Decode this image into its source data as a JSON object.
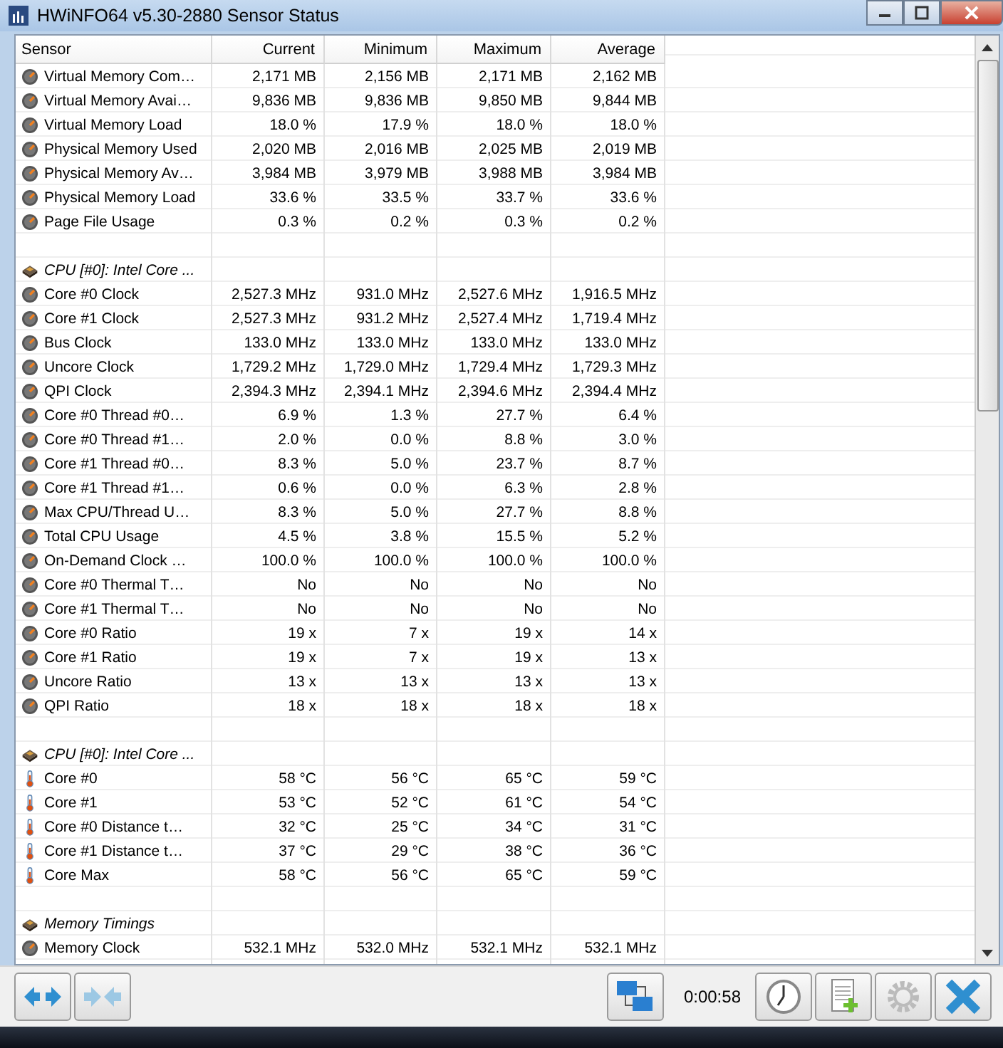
{
  "window": {
    "title": "HWiNFO64 v5.30-2880 Sensor Status"
  },
  "table": {
    "columns": [
      "Sensor",
      "Current",
      "Minimum",
      "Maximum",
      "Average"
    ],
    "rows": [
      {
        "kind": "reading",
        "cells": [
          "Virtual Memory Com…",
          "2,171 MB",
          "2,156 MB",
          "2,171 MB",
          "2,162 MB"
        ]
      },
      {
        "kind": "reading",
        "cells": [
          "Virtual Memory Avai…",
          "9,836 MB",
          "9,836 MB",
          "9,850 MB",
          "9,844 MB"
        ]
      },
      {
        "kind": "reading",
        "cells": [
          "Virtual Memory Load",
          "18.0 %",
          "17.9 %",
          "18.0 %",
          "18.0 %"
        ]
      },
      {
        "kind": "reading",
        "cells": [
          "Physical Memory Used",
          "2,020 MB",
          "2,016 MB",
          "2,025 MB",
          "2,019 MB"
        ]
      },
      {
        "kind": "reading",
        "cells": [
          "Physical Memory Av…",
          "3,984 MB",
          "3,979 MB",
          "3,988 MB",
          "3,984 MB"
        ]
      },
      {
        "kind": "reading",
        "cells": [
          "Physical Memory Load",
          "33.6 %",
          "33.5 %",
          "33.7 %",
          "33.6 %"
        ]
      },
      {
        "kind": "reading",
        "cells": [
          "Page File Usage",
          "0.3 %",
          "0.2 %",
          "0.3 %",
          "0.2 %"
        ]
      },
      {
        "kind": "blank"
      },
      {
        "kind": "header",
        "label": "CPU [#0]: Intel Core ..."
      },
      {
        "kind": "reading",
        "cells": [
          "Core #0 Clock",
          "2,527.3 MHz",
          "931.0 MHz",
          "2,527.6 MHz",
          "1,916.5 MHz"
        ]
      },
      {
        "kind": "reading",
        "cells": [
          "Core #1 Clock",
          "2,527.3 MHz",
          "931.2 MHz",
          "2,527.4 MHz",
          "1,719.4 MHz"
        ]
      },
      {
        "kind": "reading",
        "cells": [
          "Bus Clock",
          "133.0 MHz",
          "133.0 MHz",
          "133.0 MHz",
          "133.0 MHz"
        ]
      },
      {
        "kind": "reading",
        "cells": [
          "Uncore Clock",
          "1,729.2 MHz",
          "1,729.0 MHz",
          "1,729.4 MHz",
          "1,729.3 MHz"
        ]
      },
      {
        "kind": "reading",
        "cells": [
          "QPI Clock",
          "2,394.3 MHz",
          "2,394.1 MHz",
          "2,394.6 MHz",
          "2,394.4 MHz"
        ]
      },
      {
        "kind": "reading",
        "cells": [
          "Core #0 Thread #0…",
          "6.9 %",
          "1.3 %",
          "27.7 %",
          "6.4 %"
        ]
      },
      {
        "kind": "reading",
        "cells": [
          "Core #0 Thread #1…",
          "2.0 %",
          "0.0 %",
          "8.8 %",
          "3.0 %"
        ]
      },
      {
        "kind": "reading",
        "cells": [
          "Core #1 Thread #0…",
          "8.3 %",
          "5.0 %",
          "23.7 %",
          "8.7 %"
        ]
      },
      {
        "kind": "reading",
        "cells": [
          "Core #1 Thread #1…",
          "0.6 %",
          "0.0 %",
          "6.3 %",
          "2.8 %"
        ]
      },
      {
        "kind": "reading",
        "cells": [
          "Max CPU/Thread U…",
          "8.3 %",
          "5.0 %",
          "27.7 %",
          "8.8 %"
        ]
      },
      {
        "kind": "reading",
        "cells": [
          "Total CPU Usage",
          "4.5 %",
          "3.8 %",
          "15.5 %",
          "5.2 %"
        ]
      },
      {
        "kind": "reading",
        "cells": [
          "On-Demand Clock …",
          "100.0 %",
          "100.0 %",
          "100.0 %",
          "100.0 %"
        ]
      },
      {
        "kind": "reading",
        "cells": [
          "Core #0 Thermal T…",
          "No",
          "No",
          "No",
          "No"
        ]
      },
      {
        "kind": "reading",
        "cells": [
          "Core #1 Thermal T…",
          "No",
          "No",
          "No",
          "No"
        ]
      },
      {
        "kind": "reading",
        "cells": [
          "Core #0 Ratio",
          "19 x",
          "7 x",
          "19 x",
          "14 x"
        ]
      },
      {
        "kind": "reading",
        "cells": [
          "Core #1 Ratio",
          "19 x",
          "7 x",
          "19 x",
          "13 x"
        ]
      },
      {
        "kind": "reading",
        "cells": [
          "Uncore Ratio",
          "13 x",
          "13 x",
          "13 x",
          "13 x"
        ]
      },
      {
        "kind": "reading",
        "cells": [
          "QPI Ratio",
          "18 x",
          "18 x",
          "18 x",
          "18 x"
        ]
      },
      {
        "kind": "blank"
      },
      {
        "kind": "header",
        "label": "CPU [#0]: Intel Core ..."
      },
      {
        "kind": "temperature",
        "cells": [
          "Core #0",
          "58 °C",
          "56 °C",
          "65 °C",
          "59 °C"
        ]
      },
      {
        "kind": "temperature",
        "cells": [
          "Core #1",
          "53 °C",
          "52 °C",
          "61 °C",
          "54 °C"
        ]
      },
      {
        "kind": "temperature",
        "cells": [
          "Core #0 Distance t…",
          "32 °C",
          "25 °C",
          "34 °C",
          "31 °C"
        ]
      },
      {
        "kind": "temperature",
        "cells": [
          "Core #1 Distance t…",
          "37 °C",
          "29 °C",
          "38 °C",
          "36 °C"
        ]
      },
      {
        "kind": "temperature",
        "cells": [
          "Core Max",
          "58 °C",
          "56 °C",
          "65 °C",
          "59 °C"
        ]
      },
      {
        "kind": "blank"
      },
      {
        "kind": "header",
        "label": "Memory Timings"
      },
      {
        "kind": "reading",
        "cells": [
          "Memory Clock",
          "532.1 MHz",
          "532.0 MHz",
          "532.1 MHz",
          "532.1 MHz"
        ]
      }
    ]
  },
  "toolbar": {
    "elapsed": "0:00:58"
  }
}
